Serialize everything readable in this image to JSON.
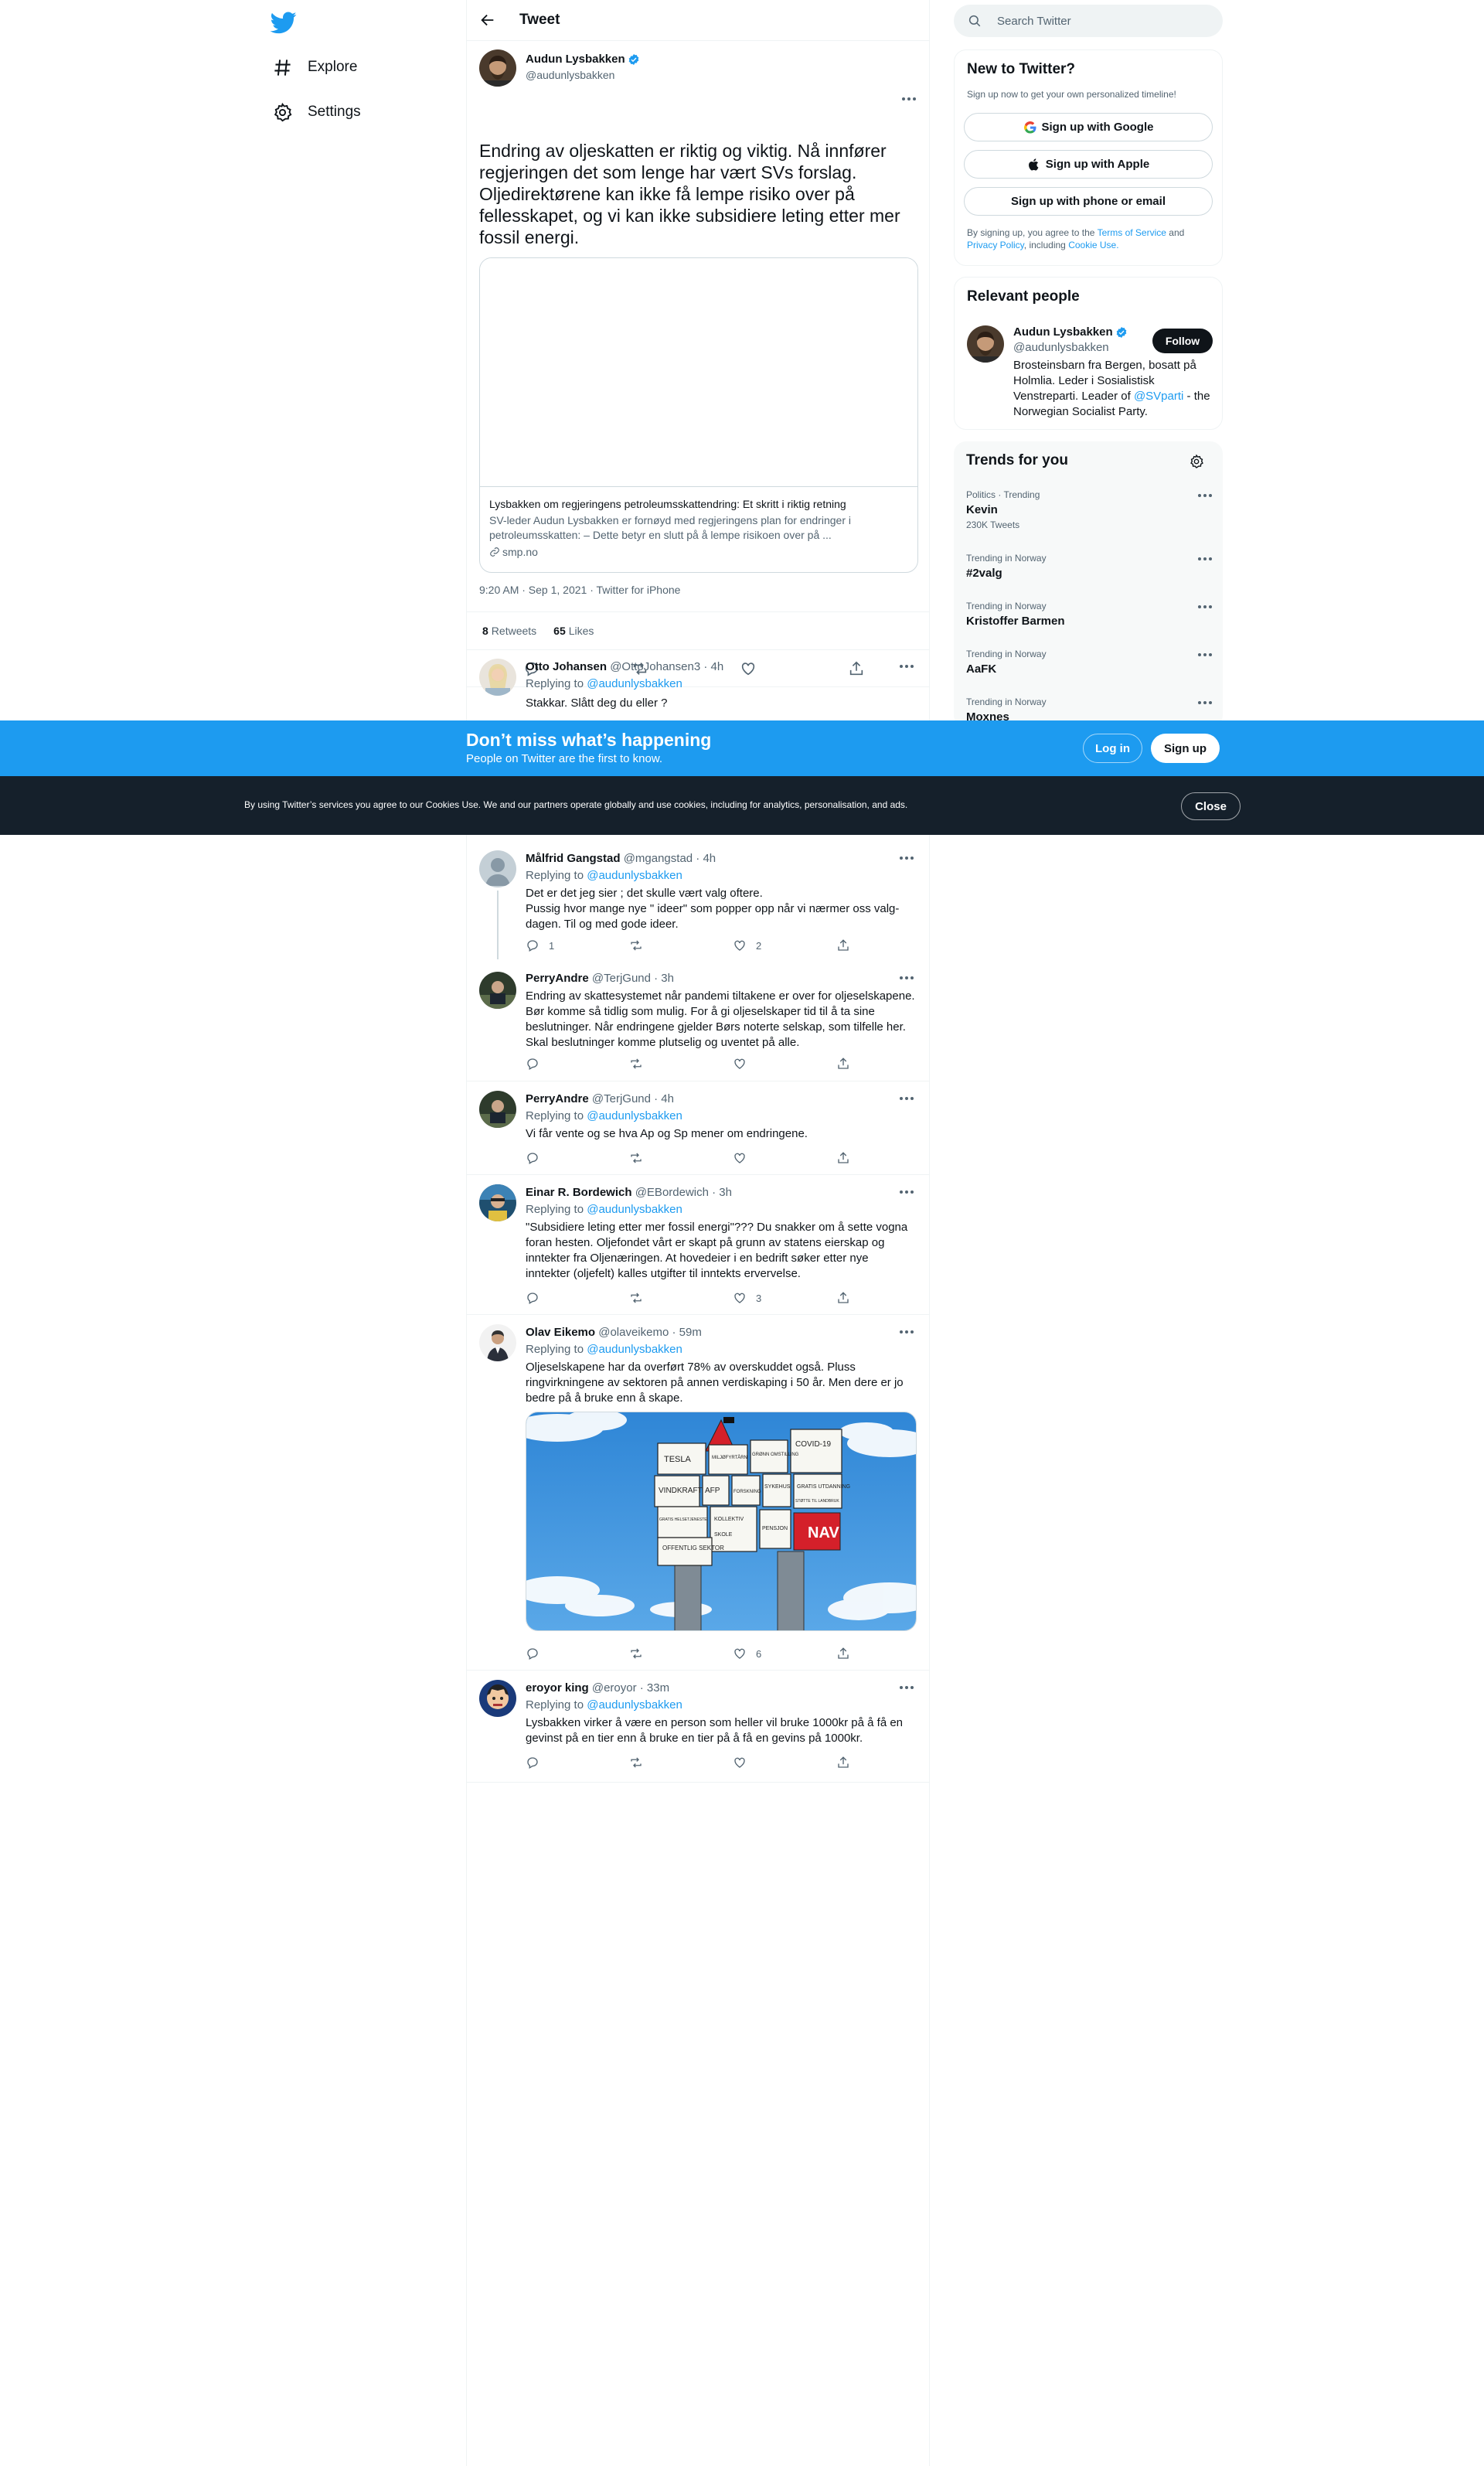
{
  "nav": {
    "items": [
      {
        "label": "Explore",
        "icon": "hashtag-icon"
      },
      {
        "label": "Settings",
        "icon": "gear-icon"
      }
    ]
  },
  "header": {
    "title": "Tweet"
  },
  "main_tweet": {
    "name": "Audun Lysbakken",
    "handle": "@audunlysbakken",
    "text": "Endring av oljeskatten er riktig og viktig. Nå innfører regjeringen det som lenge har vært SVs forslag. Oljedirektørene kan ikke få lempe risiko over på fellesskapet, og vi kan ikke subsidiere leting etter mer fossil energi.",
    "card": {
      "title": "Lysbakken om regjeringens petroleumsskattendring: Et skritt i riktig retning",
      "description": "SV-leder Audun Lysbakken er fornøyd med regjeringens plan for endringer i petroleumsskatten: – Dette betyr en slutt på å lempe risikoen over på ...",
      "domain": "smp.no"
    },
    "timestamp": "9:20 AM · Sep 1, 2021 · Twitter for iPhone",
    "retweets_count": "8",
    "retweets_label": "Retweets",
    "likes_count": "65",
    "likes_label": "Likes"
  },
  "replies": [
    {
      "name": "Otto Johansen",
      "meta": "@OttoJohansen3 · 4h",
      "replying_prefix": "Replying to",
      "replying_to": "@audunlysbakken",
      "text": "Stakkar. Slått deg du eller ?"
    },
    {
      "name": "Målfrid Gangstad",
      "meta": "@mgangstad · 4h",
      "replying_prefix": "Replying to",
      "replying_to": "@audunlysbakken",
      "text_lines": [
        "Det er det jeg sier ; det skulle vært valg oftere.",
        "Pussig hvor mange nye \" ideer\" som popper opp når vi nærmer oss valg-",
        "dagen. Til og med gode ideer."
      ],
      "replies": "1",
      "retweets": "",
      "likes": "2"
    },
    {
      "name": "PerryAndre",
      "meta": "@TerjGund · 3h",
      "text": "Endring av skattesystemet når pandemi tiltakene er over for oljeselskapene. Bør komme så tidlig som mulig. For å gi oljeselskaper tid til å ta sine beslutninger. Når endringene gjelder Børs noterte selskap, som tilfelle her. Skal beslutninger komme plutselig og uventet på alle."
    },
    {
      "name": "PerryAndre",
      "meta": "@TerjGund · 4h",
      "replying_prefix": "Replying to",
      "replying_to": "@audunlysbakken",
      "text": "Vi får vente og se hva Ap og Sp mener om endringene."
    },
    {
      "name": "Einar R. Bordewich",
      "meta": "@EBordewich · 3h",
      "replying_prefix": "Replying to",
      "replying_to": "@audunlysbakken",
      "text": "\"Subsidiere leting etter mer fossil energi\"??? Du snakker om å sette vogna foran hesten. Oljefondet vårt er skapt på grunn av statens eierskap og inntekter fra Oljenæringen. At hovedeier i en bedrift søker etter nye inntekter (oljefelt) kalles utgifter til inntekts ervervelse.",
      "likes": "3"
    },
    {
      "name": "Olav Eikemo",
      "meta": "@olaveikemo · 59m",
      "replying_prefix": "Replying to",
      "replying_to": "@audunlysbakken",
      "text": "Oljeselskapene har da overført 78% av overskuddet også. Pluss ringvirkningene av sektoren på annen verdiskaping i 50 år. Men dere er jo bedre på å bruke enn å skape.",
      "likes": "6"
    },
    {
      "name": "eroyor king",
      "meta": "@eroyor · 33m",
      "replying_prefix": "Replying to",
      "replying_to": "@audunlysbakken",
      "text": "Lysbakken virker å være en person som heller vil bruke 1000kr på å få en gevinst på en tier enn å bruke en tier på å få en gevins på 1000kr."
    }
  ],
  "cartoon": {
    "labels": [
      "TESLA",
      "VINDKRAFT",
      "AFP",
      "COVID-19",
      "NAV",
      "OFFENTLIG SEKTOR",
      "MILJØFYRTÅRN",
      "GRØNN OMSTILLING",
      "FORSKNING",
      "GRATIS UTDANNING",
      "STØTTE TIL LANDBRUK",
      "GRATIS HELSETJENESTE",
      "SYKEHUS",
      "PENSJON",
      "KOLLEKTIV",
      "SKOLE"
    ]
  },
  "search": {
    "placeholder": "Search Twitter"
  },
  "new_to_twitter": {
    "title": "New to Twitter?",
    "subtitle": "Sign up now to get your own personalized timeline!",
    "google": "Sign up with Google",
    "apple": "Sign up with Apple",
    "phone": "Sign up with phone or email",
    "legal_1": "By signing up, you agree to the",
    "tos": "Terms of Service",
    "and": "and",
    "privacy": "Privacy Policy",
    "including": ", including",
    "cookie": "Cookie Use."
  },
  "relevant": {
    "title": "Relevant people",
    "name": "Audun Lysbakken",
    "handle": "@audunlysbakken",
    "follow": "Follow",
    "bio_1": "Brosteinsbarn fra Bergen, bosatt på Holmlia. Leder i Sosialistisk Venstreparti. Leader of",
    "bio_link": "@SVparti",
    "bio_2": "- the Norwegian Socialist Party."
  },
  "trends": {
    "title": "Trends for you",
    "items": [
      {
        "category": "Politics · Trending",
        "name": "Kevin",
        "count": "230K Tweets"
      },
      {
        "category": "Trending in Norway",
        "name": "#2valg",
        "count": ""
      },
      {
        "category": "Trending in Norway",
        "name": "Kristoffer Barmen",
        "count": ""
      },
      {
        "category": "Trending in Norway",
        "name": "AaFK",
        "count": ""
      },
      {
        "category": "Trending in Norway",
        "name": "Moxnes",
        "count": ""
      }
    ]
  },
  "signup_bar": {
    "heading": "Don’t miss what’s happening",
    "sub": "People on Twitter are the first to know.",
    "login": "Log in",
    "signup": "Sign up"
  },
  "cookie_bar": {
    "text": "By using Twitter’s services you agree to our Cookies Use. We and our partners operate globally and use cookies, including for analytics, personalisation, and ads.",
    "close": "Close"
  },
  "colors": {
    "accent": "#1d9bf0",
    "text": "#0f1419",
    "muted": "#536471",
    "cookie_bg": "#15202b"
  }
}
